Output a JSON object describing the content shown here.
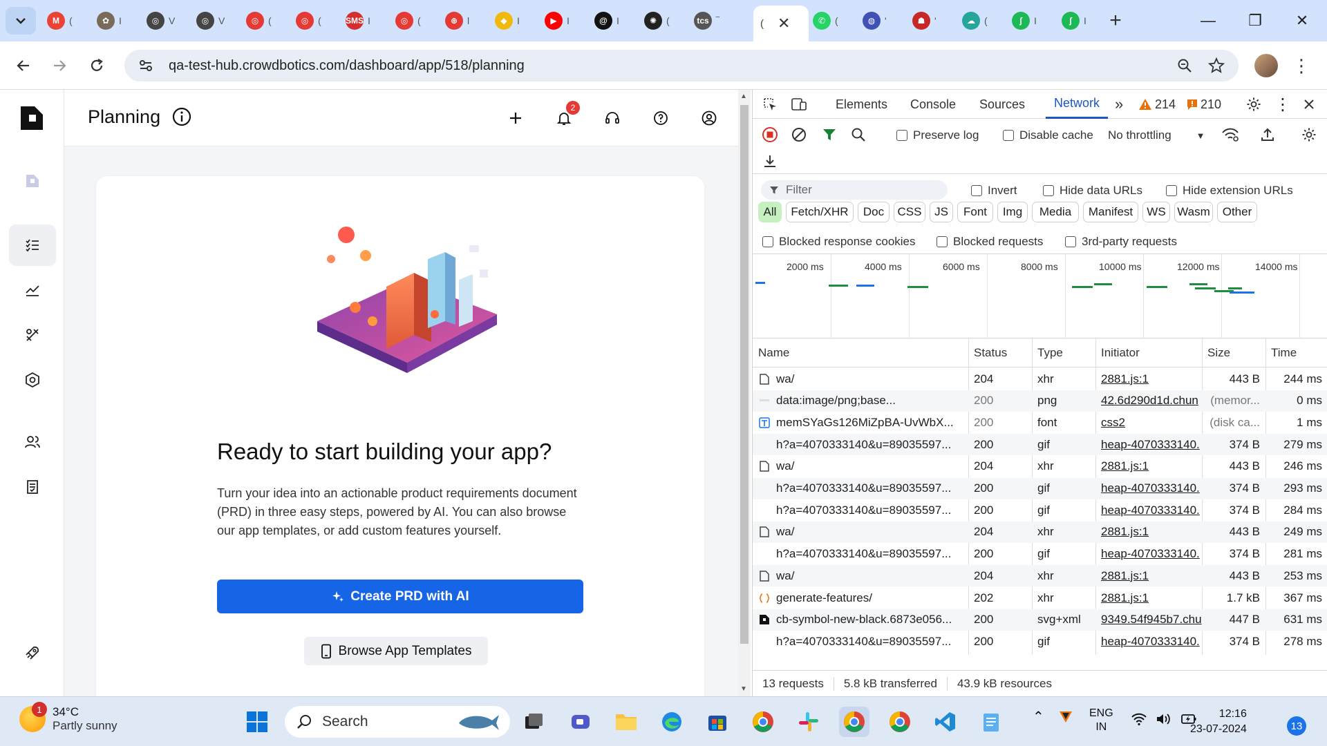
{
  "browser": {
    "tabs": [
      {
        "icon": "gmail-icon",
        "color": "#ea4335",
        "glyph": "M",
        "tail": "("
      },
      {
        "icon": "emblem-icon",
        "color": "#7a6a5a",
        "glyph": "✿",
        "tail": "I"
      },
      {
        "icon": "openai-icon",
        "color": "#444444",
        "glyph": "◎",
        "tail": "V"
      },
      {
        "icon": "openai-icon",
        "color": "#444444",
        "glyph": "◎",
        "tail": "V"
      },
      {
        "icon": "target-icon",
        "color": "#e53935",
        "glyph": "◎",
        "tail": "("
      },
      {
        "icon": "target-icon",
        "color": "#e53935",
        "glyph": "◎",
        "tail": "("
      },
      {
        "icon": "sms-icon",
        "color": "#d32f2f",
        "glyph": "SMS",
        "tail": "I"
      },
      {
        "icon": "target-icon",
        "color": "#e53935",
        "glyph": "◎",
        "tail": "("
      },
      {
        "icon": "grid-icon",
        "color": "#e53935",
        "glyph": "⊕",
        "tail": "l"
      },
      {
        "icon": "binance-icon",
        "color": "#f0b90b",
        "glyph": "◆",
        "tail": "I"
      },
      {
        "icon": "youtube-icon",
        "color": "#ff0000",
        "glyph": "▶",
        "tail": "I"
      },
      {
        "icon": "threads-icon",
        "color": "#111111",
        "glyph": "@",
        "tail": "I"
      },
      {
        "icon": "chatgpt-icon",
        "color": "#222222",
        "glyph": "✺",
        "tail": "("
      },
      {
        "icon": "tcs-icon",
        "color": "#555555",
        "glyph": "tcs",
        "tail": "‾"
      },
      {
        "icon": "whatsapp-icon",
        "color": "#25d366",
        "glyph": "✆",
        "tail": "("
      },
      {
        "icon": "globe-icon",
        "color": "#3f51b5",
        "glyph": "◍",
        "tail": "'"
      },
      {
        "icon": "people-icon",
        "color": "#c62828",
        "glyph": "☗",
        "tail": "'"
      },
      {
        "icon": "cloud-icon",
        "color": "#26a69a",
        "glyph": "☁",
        "tail": "("
      },
      {
        "icon": "app-icon",
        "color": "#1db954",
        "glyph": "ʃ",
        "tail": "I"
      },
      {
        "icon": "app-icon",
        "color": "#1db954",
        "glyph": "ʃ",
        "tail": "I"
      }
    ],
    "active_tab": {
      "glyph": "(",
      "close": "✕"
    },
    "new_tab": "+",
    "window_controls": {
      "minimize": "—",
      "maximize": "❐",
      "close": "✕"
    },
    "url": "qa-test-hub.crowdbotics.com/dashboard/app/518/planning"
  },
  "app": {
    "title": "Planning",
    "notification_count": "2",
    "heading": "Ready to start building your app?",
    "description": "Turn your idea into an actionable product requirements document (PRD) in three easy steps, powered by AI. You can also browse our app templates, or add custom features yourself.",
    "primary_button": "Create PRD with AI",
    "secondary_button": "Browse App Templates"
  },
  "devtools": {
    "tabs": [
      "Elements",
      "Console",
      "Sources",
      "Network"
    ],
    "active_tab": "Network",
    "more": "»",
    "warnings": "214",
    "errors": "210",
    "preserve_log": "Preserve log",
    "disable_cache": "Disable cache",
    "throttling": "No throttling",
    "filter_placeholder": "Filter",
    "invert": "Invert",
    "hide_data_urls": "Hide data URLs",
    "hide_extension_urls": "Hide extension URLs",
    "type_filters": [
      "All",
      "Fetch/XHR",
      "Doc",
      "CSS",
      "JS",
      "Font",
      "Img",
      "Media",
      "Manifest",
      "WS",
      "Wasm",
      "Other"
    ],
    "blocked_cookies": "Blocked response cookies",
    "blocked_requests": "Blocked requests",
    "third_party": "3rd-party requests",
    "timeline_labels": [
      "2000 ms",
      "4000 ms",
      "6000 ms",
      "8000 ms",
      "10000 ms",
      "12000 ms",
      "14000 ms"
    ],
    "columns": [
      "Name",
      "Status",
      "Type",
      "Initiator",
      "Size",
      "Time"
    ],
    "requests": [
      {
        "icon": "doc-icon",
        "name": "wa/",
        "status": "204",
        "type": "xhr",
        "initiator": "2881.js:1",
        "size": "443 B",
        "time": "244 ms",
        "dim": false
      },
      {
        "icon": "image-icon",
        "name": "data:image/png;base...",
        "status": "200",
        "type": "png",
        "initiator": "42.6d290d1d.chun",
        "size": "(memor...",
        "time": "0 ms",
        "dim": true
      },
      {
        "icon": "font-icon",
        "name": "memSYaGs126MiZpBA-UvWbX...",
        "status": "200",
        "type": "font",
        "initiator": "css2",
        "size": "(disk ca...",
        "time": "1 ms",
        "dim": true
      },
      {
        "icon": "",
        "name": "h?a=4070333140&u=89035597...",
        "status": "200",
        "type": "gif",
        "initiator": "heap-4070333140.",
        "size": "374 B",
        "time": "279 ms",
        "dim": false
      },
      {
        "icon": "doc-icon",
        "name": "wa/",
        "status": "204",
        "type": "xhr",
        "initiator": "2881.js:1",
        "size": "443 B",
        "time": "246 ms",
        "dim": false
      },
      {
        "icon": "",
        "name": "h?a=4070333140&u=89035597...",
        "status": "200",
        "type": "gif",
        "initiator": "heap-4070333140.",
        "size": "374 B",
        "time": "293 ms",
        "dim": false
      },
      {
        "icon": "",
        "name": "h?a=4070333140&u=89035597...",
        "status": "200",
        "type": "gif",
        "initiator": "heap-4070333140.",
        "size": "374 B",
        "time": "284 ms",
        "dim": false
      },
      {
        "icon": "doc-icon",
        "name": "wa/",
        "status": "204",
        "type": "xhr",
        "initiator": "2881.js:1",
        "size": "443 B",
        "time": "249 ms",
        "dim": false
      },
      {
        "icon": "",
        "name": "h?a=4070333140&u=89035597...",
        "status": "200",
        "type": "gif",
        "initiator": "heap-4070333140.",
        "size": "374 B",
        "time": "281 ms",
        "dim": false
      },
      {
        "icon": "doc-icon",
        "name": "wa/",
        "status": "204",
        "type": "xhr",
        "initiator": "2881.js:1",
        "size": "443 B",
        "time": "253 ms",
        "dim": false
      },
      {
        "icon": "fetch-icon",
        "name": "generate-features/",
        "status": "202",
        "type": "xhr",
        "initiator": "2881.js:1",
        "size": "1.7 kB",
        "time": "367 ms",
        "dim": false
      },
      {
        "icon": "logo-icon",
        "name": "cb-symbol-new-black.6873e056...",
        "status": "200",
        "type": "svg+xml",
        "initiator": "9349.54f945b7.chu",
        "size": "447 B",
        "time": "631 ms",
        "dim": false
      },
      {
        "icon": "",
        "name": "h?a=4070333140&u=89035597...",
        "status": "200",
        "type": "gif",
        "initiator": "heap-4070333140.",
        "size": "374 B",
        "time": "278 ms",
        "dim": false
      }
    ],
    "summary": [
      "13 requests",
      "5.8 kB transferred",
      "43.9 kB resources"
    ]
  },
  "taskbar": {
    "weather_badge": "1",
    "temperature": "34°C",
    "condition": "Partly sunny",
    "search_placeholder": "Search",
    "language": "ENG",
    "region": "IN",
    "time": "12:16",
    "date": "23-07-2024",
    "notifications": "13"
  }
}
